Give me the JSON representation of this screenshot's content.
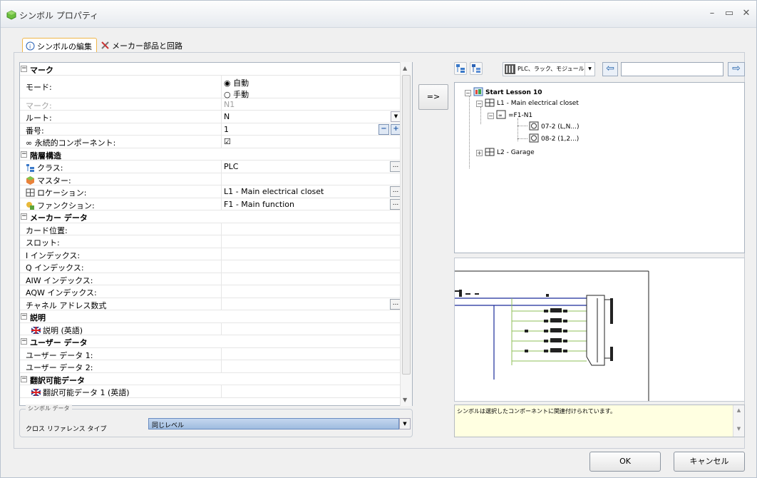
{
  "window": {
    "title": "シンボル プロパティ",
    "minimize": "–",
    "maximize": "▭",
    "close": "✕"
  },
  "tabs": [
    {
      "label": "シンボルの編集"
    },
    {
      "label": "メーカー部品と回路"
    }
  ],
  "props": {
    "cat_mark": "マーク",
    "mode_label": "モード:",
    "mode_auto": "自動",
    "mode_manual": "手動",
    "mark_label": "マーク:",
    "mark_value": "N1",
    "root_label": "ルート:",
    "root_value": "N",
    "num_label": "番号:",
    "num_value": "1",
    "perm_label": "永続的コンポーネント:",
    "perm_value": "☑",
    "cat_hier": "階層構造",
    "class_label": "クラス:",
    "class_value": "PLC",
    "master_label": "マスター:",
    "loc_label": "ロケーション:",
    "loc_value": "L1 - Main electrical closet",
    "func_label": "ファンクション:",
    "func_value": "F1 - Main function",
    "cat_maker": "メーカー データ",
    "card_label": "カード位置:",
    "slot_label": "スロット:",
    "i_label": "I インデックス:",
    "q_label": "Q インデックス:",
    "aiw_label": "AIW インデックス:",
    "aqw_label": "AQW インデックス:",
    "chan_label": "チャネル アドレス数式",
    "cat_desc": "説明",
    "desc_en_label": "説明 (英語)",
    "cat_user": "ユーザー データ",
    "ud1_label": "ユーザー データ 1:",
    "ud2_label": "ユーザー データ 2:",
    "cat_trans": "翻訳可能データ",
    "trans1_label": "翻訳可能データ 1 (英語)"
  },
  "symbol_data": {
    "legend": "シンボル データ",
    "xref_label": "クロス リファレンス タイプ",
    "xref_value": "同じレベル"
  },
  "middle": {
    "assign_button": "=>"
  },
  "right": {
    "view_selector": "PLC、ラック、モジュール",
    "search_value": "",
    "tree": {
      "root": "Start Lesson 10",
      "l1": "L1 - Main electrical closet",
      "f1n1": "=F1-N1",
      "io1": "07-2 (L,N...)",
      "io2": "08-2 (1,2...)",
      "l2": "L2 - Garage"
    },
    "info_text": "シンボルは選択したコンポーネントに関連付けられています。"
  },
  "buttons": {
    "ok": "OK",
    "cancel": "キャンセル"
  },
  "colors": {
    "accent": "#f0b64a",
    "selection": "#a8c3e5",
    "wire_green": "#8fbf5a",
    "wire_blue": "#1a2a9a"
  }
}
